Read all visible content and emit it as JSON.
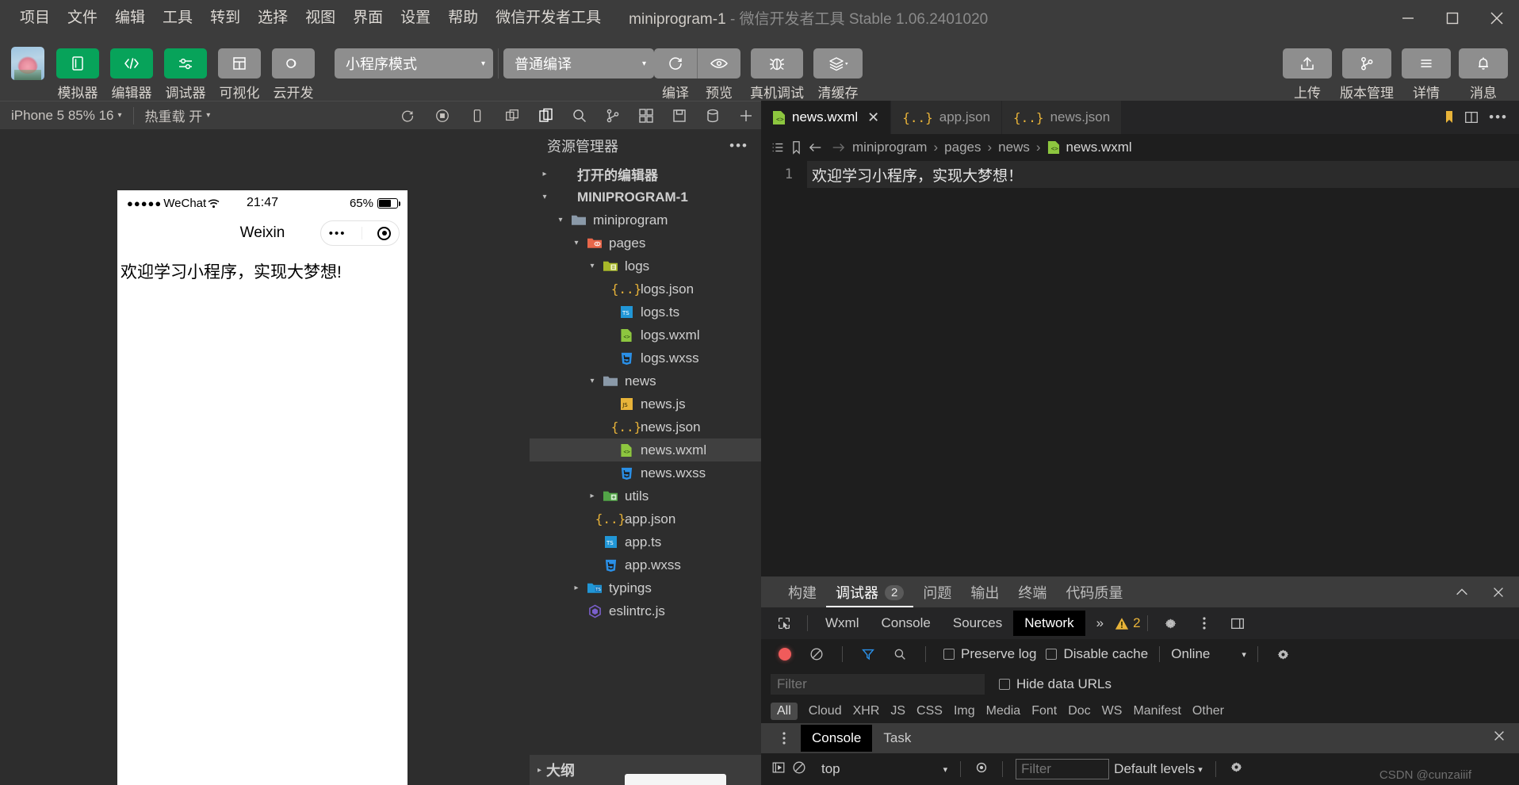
{
  "window": {
    "menus": [
      "项目",
      "文件",
      "编辑",
      "工具",
      "转到",
      "选择",
      "视图",
      "界面",
      "设置",
      "帮助",
      "微信开发者工具"
    ],
    "project_name": "miniprogram-1",
    "title_dash": "-",
    "app_name": "微信开发者工具 Stable 1.06.2401020",
    "controls": {
      "minimize": "minimize-icon",
      "maximize": "maximize-icon",
      "close": "close-icon"
    }
  },
  "toolbar": {
    "avatar": "project-avatar",
    "left_buttons": [
      {
        "label": "模拟器",
        "icon": "simulator-icon",
        "state": "green"
      },
      {
        "label": "编辑器",
        "icon": "code-icon",
        "state": "green"
      },
      {
        "label": "调试器",
        "icon": "debugger-icon",
        "state": "green"
      },
      {
        "label": "可视化",
        "icon": "layout-icon",
        "state": "gray"
      },
      {
        "label": "云开发",
        "icon": "cloud-icon",
        "state": "gray"
      }
    ],
    "mode_select": {
      "value": "小程序模式",
      "caret": "▾"
    },
    "compile_select": {
      "value": "普通编译",
      "caret": "▾"
    },
    "actions": [
      {
        "label": "编译",
        "icon": "refresh-icon"
      },
      {
        "label": "预览",
        "icon": "eye-icon"
      },
      {
        "label": "真机调试",
        "icon": "bug-icon"
      },
      {
        "label": "清缓存",
        "icon": "layers-icon"
      }
    ],
    "right_buttons": [
      {
        "label": "上传",
        "icon": "upload-icon"
      },
      {
        "label": "版本管理",
        "icon": "branch-icon"
      },
      {
        "label": "详情",
        "icon": "menu-icon"
      },
      {
        "label": "消息",
        "icon": "bell-icon"
      }
    ]
  },
  "simulator": {
    "device": "iPhone 5 85% 16",
    "device_caret": "▾",
    "hot_reload": "热重载 开",
    "hot_reload_caret": "▾",
    "icons": [
      "rotate-icon",
      "record-icon",
      "device-icon",
      "copy-icon"
    ],
    "phone": {
      "carrier_dots": "●●●●●",
      "carrier": "WeChat",
      "wifi": "wifi-icon",
      "time": "21:47",
      "battery_pct": "65%",
      "nav_title": "Weixin",
      "capsule_dots": "•••",
      "capsule_target": "target-icon",
      "content": "欢迎学习小程序，实现大梦想!"
    }
  },
  "explorer": {
    "activity_icons": [
      "files-icon",
      "search-icon",
      "source-control-icon",
      "extensions-icon",
      "save-icon",
      "cloud-db-icon",
      "more-icon"
    ],
    "title": "资源管理器",
    "more": "•••",
    "tree": [
      {
        "label": "打开的编辑器",
        "depth": 0,
        "twisty": "▸",
        "icon": "none",
        "section": true,
        "selected": false
      },
      {
        "label": "MINIPROGRAM-1",
        "depth": 0,
        "twisty": "▾",
        "icon": "none",
        "section": true,
        "selected": false
      },
      {
        "label": "miniprogram",
        "depth": 1,
        "twisty": "▾",
        "icon": "folder-gray",
        "section": false,
        "selected": false
      },
      {
        "label": "pages",
        "depth": 2,
        "twisty": "▾",
        "icon": "folder-red",
        "section": false,
        "selected": false
      },
      {
        "label": "logs",
        "depth": 3,
        "twisty": "▾",
        "icon": "folder-olive",
        "section": false,
        "selected": false
      },
      {
        "label": "logs.json",
        "depth": 4,
        "twisty": "",
        "icon": "json-icon",
        "section": false,
        "selected": false
      },
      {
        "label": "logs.ts",
        "depth": 4,
        "twisty": "",
        "icon": "ts-icon",
        "section": false,
        "selected": false
      },
      {
        "label": "logs.wxml",
        "depth": 4,
        "twisty": "",
        "icon": "wxml-icon",
        "section": false,
        "selected": false
      },
      {
        "label": "logs.wxss",
        "depth": 4,
        "twisty": "",
        "icon": "wxss-icon",
        "section": false,
        "selected": false
      },
      {
        "label": "news",
        "depth": 3,
        "twisty": "▾",
        "icon": "folder-gray",
        "section": false,
        "selected": false
      },
      {
        "label": "news.js",
        "depth": 4,
        "twisty": "",
        "icon": "js-icon",
        "section": false,
        "selected": false
      },
      {
        "label": "news.json",
        "depth": 4,
        "twisty": "",
        "icon": "json-icon",
        "section": false,
        "selected": false
      },
      {
        "label": "news.wxml",
        "depth": 4,
        "twisty": "",
        "icon": "wxml-icon",
        "section": false,
        "selected": true
      },
      {
        "label": "news.wxss",
        "depth": 4,
        "twisty": "",
        "icon": "wxss-icon",
        "section": false,
        "selected": false
      },
      {
        "label": "utils",
        "depth": 3,
        "twisty": "▸",
        "icon": "folder-green",
        "section": false,
        "selected": false
      },
      {
        "label": "app.json",
        "depth": 3,
        "twisty": "",
        "icon": "json-icon",
        "section": false,
        "selected": false
      },
      {
        "label": "app.ts",
        "depth": 3,
        "twisty": "",
        "icon": "ts-icon",
        "section": false,
        "selected": false
      },
      {
        "label": "app.wxss",
        "depth": 3,
        "twisty": "",
        "icon": "wxss-icon",
        "section": false,
        "selected": false
      },
      {
        "label": "typings",
        "depth": 2,
        "twisty": "▸",
        "icon": "folder-ts",
        "section": false,
        "selected": false
      },
      {
        "label": "eslintrc.js",
        "depth": 2,
        "twisty": "",
        "icon": "eslint-icon",
        "section": false,
        "selected": false
      }
    ],
    "outline": {
      "label": "大纲",
      "twisty": "▸"
    }
  },
  "editor": {
    "tabs": [
      {
        "label": "news.wxml",
        "icon": "wxml-icon",
        "active": true,
        "close": "✕"
      },
      {
        "label": "app.json",
        "icon": "json-icon",
        "active": false,
        "close": ""
      },
      {
        "label": "news.json",
        "icon": "json-icon",
        "active": false,
        "close": ""
      }
    ],
    "tab_actions": [
      "bookmark-icon",
      "split-editor-icon",
      "more-icon"
    ],
    "breadcrumb": {
      "list_icon": "list-icon",
      "bookmark_icon": "bookmark-icon",
      "back_icon": "arrow-left-icon",
      "forward_icon": "arrow-right-icon",
      "parts": [
        "miniprogram",
        "pages",
        "news"
      ],
      "separator": "›",
      "leaf": "news.wxml",
      "leaf_icon": "wxml-icon"
    },
    "lines": [
      {
        "no": "1",
        "text": "欢迎学习小程序，实现大梦想！"
      }
    ]
  },
  "panel": {
    "tabs": [
      {
        "label": "构建",
        "badge": "",
        "active": false
      },
      {
        "label": "调试器",
        "badge": "2",
        "active": true
      },
      {
        "label": "问题",
        "badge": "",
        "active": false
      },
      {
        "label": "输出",
        "badge": "",
        "active": false
      },
      {
        "label": "终端",
        "badge": "",
        "active": false
      },
      {
        "label": "代码质量",
        "badge": "",
        "active": false
      }
    ],
    "collapse_icon": "chevron-up-icon",
    "close_icon": "close-icon",
    "devtools": {
      "inspect_icon": "inspect-icon",
      "tabs": [
        {
          "label": "Wxml",
          "active": false
        },
        {
          "label": "Console",
          "active": false
        },
        {
          "label": "Sources",
          "active": false
        },
        {
          "label": "Network",
          "active": true
        }
      ],
      "more": "»",
      "warning_count": "2",
      "warning_icon": "warning-icon",
      "settings_icon": "gear-icon",
      "kebab_icon": "kebab-icon",
      "dock_icon": "dock-icon"
    },
    "network": {
      "record_icon": "record-icon",
      "clear_icon": "clear-icon",
      "filter_icon": "filter-icon",
      "search_icon": "search-icon",
      "preserve_log": "Preserve log",
      "disable_cache": "Disable cache",
      "throttle": "Online",
      "throttle_caret": "▾",
      "gear_icon": "gear-icon",
      "filter_placeholder": "Filter",
      "hide_data_urls": "Hide data URLs",
      "types": [
        "All",
        "Cloud",
        "XHR",
        "JS",
        "CSS",
        "Img",
        "Media",
        "Font",
        "Doc",
        "WS",
        "Manifest",
        "Other"
      ]
    },
    "drawer": {
      "kebab_icon": "kebab-icon",
      "tabs": [
        {
          "label": "Console",
          "active": true
        },
        {
          "label": "Task",
          "active": false
        }
      ],
      "close_icon": "close-icon",
      "exec_icon": "run-icon",
      "clear_icon": "clear-icon",
      "context": "top",
      "context_caret": "▾",
      "eye_icon": "eye-icon",
      "filter_placeholder": "Filter",
      "levels": "Default levels",
      "levels_caret": "▾",
      "gear_icon": "gear-icon",
      "watermark": "CSDN @cunzaiiif"
    }
  }
}
